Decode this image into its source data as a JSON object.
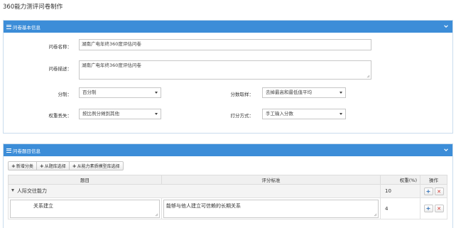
{
  "page_title": "360能力测评问卷制作",
  "panel1": {
    "title": "问卷基本信息",
    "name_label": "问卷名称：",
    "name_value": "湖南广电年终360度评估问卷",
    "desc_label": "问卷描述：",
    "desc_value": "湖南广电年终360度评估问卷",
    "score_label": "分制：",
    "score_value": "百分制",
    "sampling_label": "分数取样：",
    "sampling_value": "去掉最高和最低值平均",
    "weight_loss_label": "权重丢失：",
    "weight_loss_value": "按比例分摊到其他",
    "rating_label": "打分方式：",
    "rating_value": "手工输入分数"
  },
  "panel2": {
    "title": "问卷题目信息",
    "toolbar": {
      "add_category": "新增分类",
      "from_bank": "从题库选择",
      "from_model": "从能力素质模型库选择"
    },
    "columns": {
      "topic": "题目",
      "criteria": "评分标准",
      "weight": "权重(%)",
      "ops": "操作"
    },
    "group": {
      "name": "人际交往能力",
      "weight": "10"
    },
    "item": {
      "name": "关系建立",
      "criteria": "能够与他人建立可信赖的长期关系",
      "weight": "4"
    }
  },
  "colors": {
    "header_blue": "#3c8dd8",
    "add_blue": "#2d6db5",
    "delete_red": "#d0342c"
  }
}
